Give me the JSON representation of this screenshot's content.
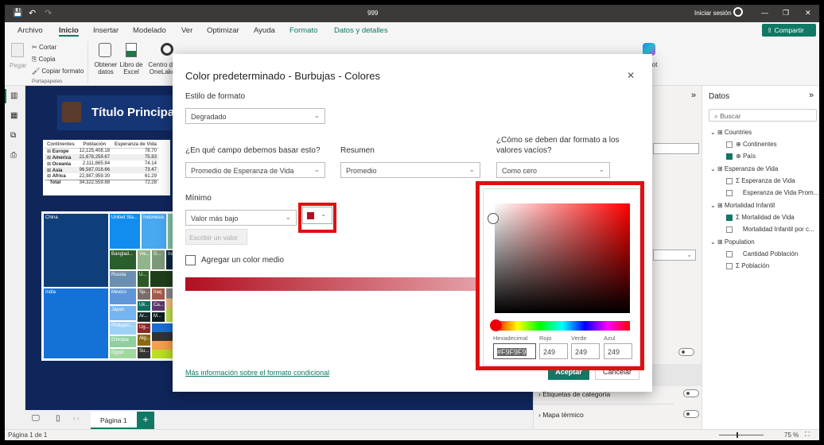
{
  "title": "999",
  "titlebar": {
    "signin": "Iniciar sesión",
    "minimize": "—",
    "restore": "❐",
    "close": "✕"
  },
  "menu": [
    "Archivo",
    "Inicio",
    "Insertar",
    "Modelado",
    "Ver",
    "Optimizar",
    "Ayuda",
    "Formato",
    "Datos y detalles"
  ],
  "share": "Compartir",
  "ribbon": {
    "paste": "Pegar",
    "cut": "Cortar",
    "copy": "Copia",
    "format_painter": "Copiar formato",
    "clipboard_group": "Portapapeles",
    "get_data": "Obtener datos",
    "excel": "Libro de Excel",
    "onelake": "Centro de OneLake",
    "copilot": "lot",
    "copilot_group": "ot"
  },
  "report": {
    "title": "Título Principal",
    "table": {
      "headers": [
        "Continentes",
        "Población",
        "Esperanza de Vida"
      ],
      "rows": [
        [
          "Europe",
          "12,125,408.18",
          "78.70"
        ],
        [
          "America",
          "21,678,259.67",
          "75.83"
        ],
        [
          "Oceania",
          "2,111,865.84",
          "74.14"
        ],
        [
          "Asia",
          "96,587,018.66",
          "73.47"
        ],
        [
          "Africa",
          "22,987,959.30",
          "61.29"
        ],
        [
          "Total",
          "34,322,559.88",
          "72.28"
        ]
      ]
    },
    "treemap": [
      "China",
      "India",
      "United Sta...",
      "Indonesia",
      "Banglad...",
      "Vie...",
      "G...",
      "Ira",
      "Russia",
      "U...",
      "Mexico",
      "Sp...",
      "Iraq",
      "Japan",
      "Uk...",
      "Ca...",
      "Ar...",
      "M...",
      "Philippin...",
      "Ug...",
      "Ethiopia",
      "Alg...",
      "Egypt",
      "Su..."
    ]
  },
  "pages": {
    "page1": "Página 1",
    "add": "+"
  },
  "status": {
    "page": "Página 1 de 1",
    "zoom": "75 %"
  },
  "format_pane": {
    "cat_labels": "Etiquetas de categoría",
    "heatmap": "Mapa térmico"
  },
  "data_pane": {
    "title": "Datos",
    "search_placeholder": "Buscar",
    "tables": [
      {
        "name": "Countries",
        "fields": [
          {
            "name": "Continentes",
            "checked": false
          },
          {
            "name": "País",
            "checked": true
          }
        ]
      },
      {
        "name": "Esperanza de Vida",
        "fields": [
          {
            "name": "Esperanza de Vida",
            "checked": false
          },
          {
            "name": "Esperanza de Vida Prom...",
            "checked": false
          }
        ]
      },
      {
        "name": "Mortalidad Infantil",
        "fields": [
          {
            "name": "Mortalidad de Vida",
            "checked": true
          },
          {
            "name": "Mortalidad Infantil por c...",
            "checked": false
          }
        ]
      },
      {
        "name": "Population",
        "fields": [
          {
            "name": "Cantidad Población",
            "checked": false
          },
          {
            "name": "Población",
            "checked": false
          }
        ]
      }
    ]
  },
  "dialog": {
    "title": "Color predeterminado - Burbujas - Colores",
    "close": "✕",
    "format_style_label": "Estilo de formato",
    "format_style": "Degradado",
    "field_label": "¿En qué campo debemos basar esto?",
    "field": "Promedio de Esperanza de Vida",
    "summary_label": "Resumen",
    "summary": "Promedio",
    "empty_label": "¿Cómo se deben dar formato a los valores vacíos?",
    "empty": "Como cero",
    "min_label": "Mínimo",
    "min": "Valor más bajo",
    "min_color": "#b01020",
    "enter_value": "Escribir un valor",
    "middle_color": "Agregar un color medio",
    "more_info": "Más información sobre el formato condicional",
    "ok": "Aceptar",
    "cancel": "Cancelar"
  },
  "picker": {
    "hex_label": "Hexadecimal",
    "red_label": "Rojo",
    "green_label": "Verde",
    "blue_label": "Azul",
    "hex": "#F9F9F9",
    "red": "249",
    "green": "249",
    "blue": "249"
  }
}
